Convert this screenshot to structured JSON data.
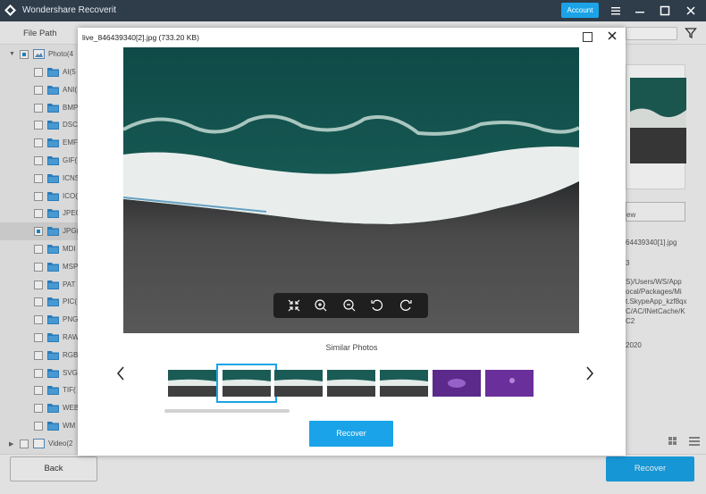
{
  "app": {
    "title": "Wondershare Recoverit",
    "account_label": "Account"
  },
  "toolbar": {
    "file_path_label": "File Path"
  },
  "tree": {
    "root_label": "Photo(4",
    "items": [
      {
        "label": "AI(5",
        "checked": false
      },
      {
        "label": "ANI(",
        "checked": false
      },
      {
        "label": "BMP",
        "checked": false
      },
      {
        "label": "DSC",
        "checked": false
      },
      {
        "label": "EMF",
        "checked": false
      },
      {
        "label": "GIF(",
        "checked": false
      },
      {
        "label": "ICNS",
        "checked": false
      },
      {
        "label": "ICO(",
        "checked": false
      },
      {
        "label": "JPEG",
        "checked": false
      },
      {
        "label": "JPG(",
        "checked": true
      },
      {
        "label": "MDI",
        "checked": false
      },
      {
        "label": "MSP",
        "checked": false
      },
      {
        "label": "PAT",
        "checked": false
      },
      {
        "label": "PIC(",
        "checked": false
      },
      {
        "label": "PNG",
        "checked": false
      },
      {
        "label": "RAW",
        "checked": false
      },
      {
        "label": "RGB",
        "checked": false
      },
      {
        "label": "SVG",
        "checked": false
      },
      {
        "label": "TIF(",
        "checked": false
      },
      {
        "label": "WEB",
        "checked": false
      },
      {
        "label": "WM",
        "checked": false
      }
    ],
    "bottom_label": "Video(2"
  },
  "right_panel": {
    "preview_label": "ew",
    "file_name": "64439340[1].jpg",
    "size": "3",
    "path": "S)/Users/WS/App\nocal/Packages/Mi\nt.SkypeApp_kzf8qx\nC/AC/INetCache/K\nC2",
    "date": "2020"
  },
  "dialog": {
    "title": "live_846439340[2].jpg (733.20 KB)",
    "similar_label": "Similar Photos",
    "recover_label": "Recover"
  },
  "footer": {
    "back_label": "Back",
    "recover_label": "Recover"
  },
  "colors": {
    "accent": "#1aa3e8",
    "titlebar": "#2f3c4a"
  }
}
